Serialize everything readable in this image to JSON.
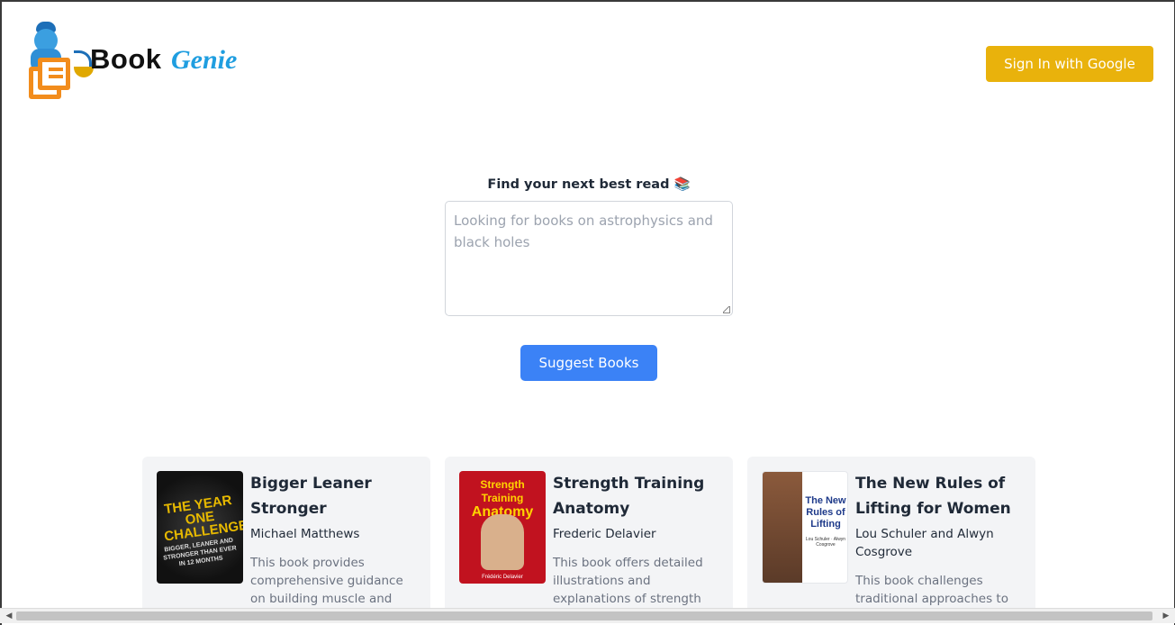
{
  "header": {
    "brand_word1": "Book",
    "brand_word2": "Genie",
    "signin_label": "Sign In with Google"
  },
  "search": {
    "label": "Find your next best read 📚",
    "placeholder": "Looking for books on astrophysics and black holes",
    "value": "",
    "submit_label": "Suggest Books"
  },
  "books": [
    {
      "title": "Bigger Leaner Stronger",
      "author": "Michael Matthews",
      "description": "This book provides comprehensive guidance on building muscle and losing fat",
      "cover_text": "THE YEAR ONE CHALLENGE",
      "cover_subtext": "BIGGER, LEANER AND STRONGER THAN EVER IN 12 MONTHS"
    },
    {
      "title": "Strength Training Anatomy",
      "author": "Frederic Delavier",
      "description": "This book offers detailed illustrations and explanations of strength training exercises,",
      "cover_text": "Strength Training",
      "cover_text2": "Anatomy",
      "cover_subtext": "Frédéric Delavier"
    },
    {
      "title": "The New Rules of Lifting for Women",
      "author": "Lou Schuler and Alwyn Cosgrove",
      "description": "This book challenges traditional approaches to",
      "cover_text": "The New Rules of Lifting",
      "cover_subtext": "Lou Schuler · Alwyn Cosgrove"
    }
  ],
  "colors": {
    "signin_bg": "#e9b20c",
    "suggest_bg": "#3b82f6",
    "brand_accent": "#1f9ee0",
    "logo_orange": "#f28c1c",
    "card_bg": "#f3f4f6"
  }
}
